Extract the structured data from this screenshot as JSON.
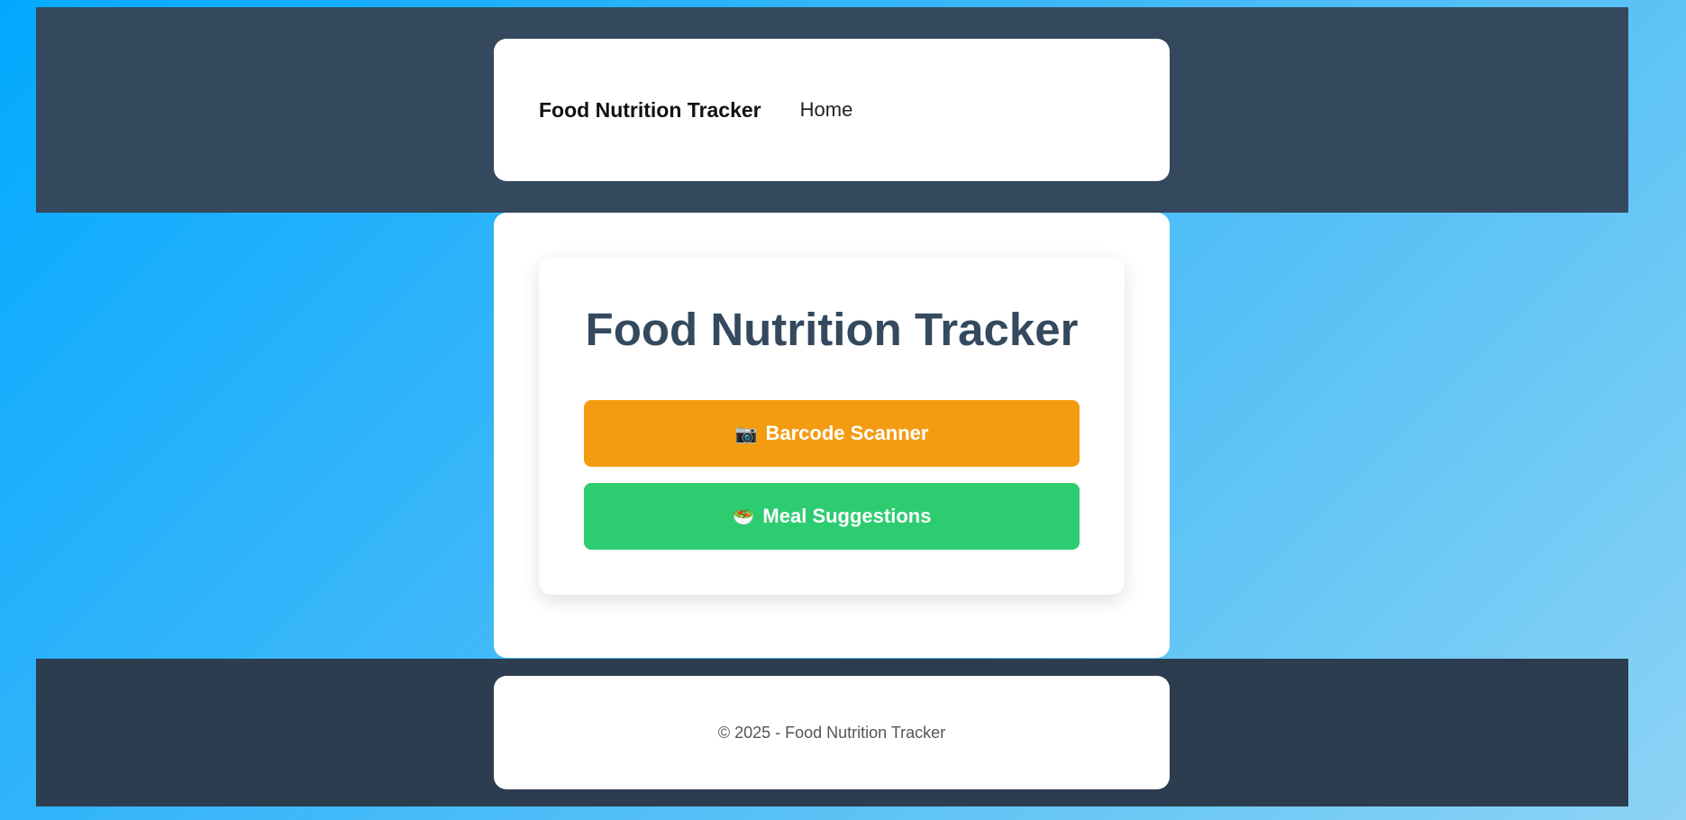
{
  "header": {
    "brand": "Food Nutrition Tracker",
    "nav_home": "Home"
  },
  "main": {
    "title": "Food Nutrition Tracker",
    "buttons": [
      {
        "icon": "📷",
        "icon_name": "camera-icon",
        "label": "Barcode Scanner",
        "color": "#f39c12"
      },
      {
        "icon": "🥗",
        "icon_name": "salad-icon",
        "label": "Meal Suggestions",
        "color": "#2ecc71"
      }
    ]
  },
  "footer": {
    "text": "© 2025 - Food Nutrition Tracker"
  },
  "colors": {
    "header_band": "#34495e",
    "footer_band": "#2d3d50",
    "title": "#34495e"
  }
}
